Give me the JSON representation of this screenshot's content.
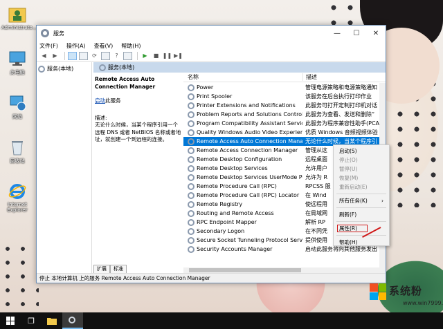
{
  "desktop": {
    "icons": [
      {
        "label": "Administrato...",
        "icon": "user-folder-icon"
      },
      {
        "label": "此电脑",
        "icon": "computer-icon"
      },
      {
        "label": "网络",
        "icon": "network-icon"
      },
      {
        "label": "回收站",
        "icon": "recycle-bin-icon"
      },
      {
        "label": "Internet Explorer",
        "icon": "ie-icon"
      }
    ]
  },
  "window": {
    "title": "服务",
    "controls": {
      "minimize": "—",
      "maximize": "☐",
      "close": "✕"
    },
    "menu": [
      "文件(F)",
      "操作(A)",
      "查看(V)",
      "帮助(H)"
    ],
    "tree": {
      "item": "服务(本地)"
    },
    "header": "服务(本地)",
    "detail": {
      "service_title": "Remote Access Auto Connection Manager",
      "start_link": "启动",
      "start_suffix": "此服务",
      "desc_label": "描述:",
      "desc_text": "无论什么时候，当某个程序引用一个远程 DNS 或者 NetBIOS 名称或者地址，就创建一个到远程的连接。"
    },
    "columns": {
      "name": "名称",
      "desc": "描述"
    },
    "rows": [
      {
        "name": "Power",
        "desc": "管理电源策略和电源策略通知"
      },
      {
        "name": "Print Spooler",
        "desc": "该服务在后台执行打印作业"
      },
      {
        "name": "Printer Extensions and Notifications",
        "desc": "此服务可打开定制打印机对话"
      },
      {
        "name": "Problem Reports and Solutions Control ...",
        "desc": "此服务为查看、发送和删除“"
      },
      {
        "name": "Program Compatibility Assistant Service",
        "desc": "此服务为程序兼容性助手(PCA)"
      },
      {
        "name": "Quality Windows Audio Video Experience",
        "desc": "优质 Windows 音频视频体验"
      },
      {
        "name": "Remote Access Auto Connection Manager",
        "desc": "无论什么时候，当某个程序引"
      },
      {
        "name": "Remote Access Connection Manager",
        "desc": "管理从这"
      },
      {
        "name": "Remote Desktop Configuration",
        "desc": "远程桌面"
      },
      {
        "name": "Remote Desktop Services",
        "desc": "允许用户"
      },
      {
        "name": "Remote Desktop Services UserMode Por...",
        "desc": "允许为 R"
      },
      {
        "name": "Remote Procedure Call (RPC)",
        "desc": "RPCSS 服"
      },
      {
        "name": "Remote Procedure Call (RPC) Locator",
        "desc": "在 Wind"
      },
      {
        "name": "Remote Registry",
        "desc": "使远程用"
      },
      {
        "name": "Routing and Remote Access",
        "desc": "在局域网"
      },
      {
        "name": "RPC Endpoint Mapper",
        "desc": "解析 RP"
      },
      {
        "name": "Secondary Logon",
        "desc": "在不同凭"
      },
      {
        "name": "Secure Socket Tunneling Protocol Service",
        "desc": "提供使用"
      },
      {
        "name": "Security Accounts Manager",
        "desc": "启动此服务将向其他服务发出"
      }
    ],
    "selected_row": 6,
    "tabs": [
      "扩展",
      "标准"
    ],
    "status": "停止 本地计算机 上的服务 Remote Access Auto Connection Manager"
  },
  "context_menu": {
    "items": [
      {
        "label": "启动(S)",
        "disabled": false
      },
      {
        "label": "停止(O)",
        "disabled": true
      },
      {
        "label": "暂停(U)",
        "disabled": true
      },
      {
        "label": "恢复(M)",
        "disabled": true
      },
      {
        "label": "重新启动(E)",
        "disabled": true
      },
      {
        "label": "所有任务(K)",
        "disabled": false
      },
      {
        "label": "刷新(F)",
        "disabled": false
      },
      {
        "label": "属性(R)",
        "disabled": false
      },
      {
        "label": "帮助(H)",
        "disabled": false
      }
    ],
    "submenu_arrow": "›"
  },
  "watermark": {
    "brand": "系统粉",
    "site": "www.win7999.com"
  },
  "colors": {
    "selection": "#0078d7",
    "highlight_box": "#d01818",
    "taskbar": "#101010"
  }
}
